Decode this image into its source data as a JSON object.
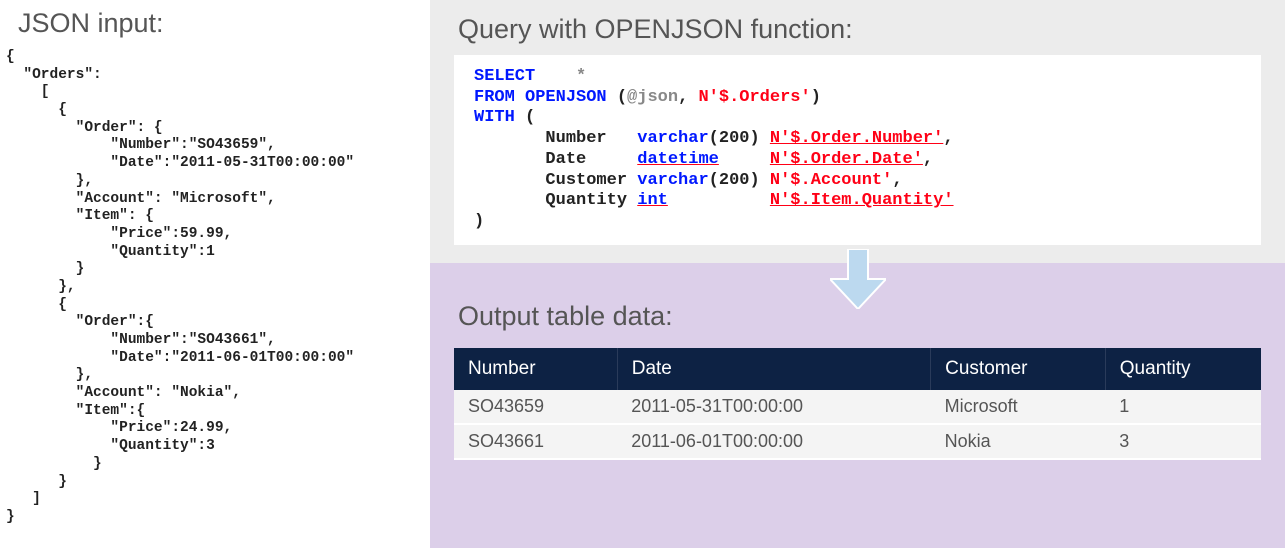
{
  "left": {
    "heading": "JSON input:",
    "json_text": "{\n  \"Orders\":\n    [\n      {\n        \"Order\": {\n            \"Number\":\"SO43659\",\n            \"Date\":\"2011-05-31T00:00:00\"\n        },\n        \"Account\": \"Microsoft\",\n        \"Item\": {\n            \"Price\":59.99,\n            \"Quantity\":1\n        }\n      },\n      {\n        \"Order\":{\n            \"Number\":\"SO43661\",\n            \"Date\":\"2011-06-01T00:00:00\"\n        },\n        \"Account\": \"Nokia\",\n        \"Item\":{\n            \"Price\":24.99,\n            \"Quantity\":3\n          }\n      }\n   ]\n}"
  },
  "query": {
    "heading": "Query with OPENJSON function:",
    "keywords": {
      "select": "SELECT",
      "star": "*",
      "from": "FROM",
      "openjson": "OPENJSON",
      "json_var": "@json",
      "orders_path": "N'$.Orders'",
      "with": "WITH",
      "open_paren": "(",
      "close_paren": ")"
    },
    "cols": [
      {
        "name": "Number",
        "type": "varchar",
        "args": "(200)",
        "path": "N'$.Order.Number'",
        "trail": ","
      },
      {
        "name": "Date",
        "type": "datetime",
        "args": "",
        "path": "N'$.Order.Date'",
        "trail": ","
      },
      {
        "name": "Customer",
        "type": "varchar",
        "args": "(200)",
        "path": "N'$.Account'",
        "trail": ","
      },
      {
        "name": "Quantity",
        "type": "int",
        "args": "",
        "path": "N'$.Item.Quantity'",
        "trail": ""
      }
    ]
  },
  "output": {
    "heading": "Output table data:",
    "columns": [
      "Number",
      "Date",
      "Customer",
      "Quantity"
    ],
    "rows": [
      [
        "SO43659",
        "2011-05-31T00:00:00",
        "Microsoft",
        "1"
      ],
      [
        "SO43661",
        "2011-06-01T00:00:00",
        "Nokia",
        "3"
      ]
    ]
  }
}
